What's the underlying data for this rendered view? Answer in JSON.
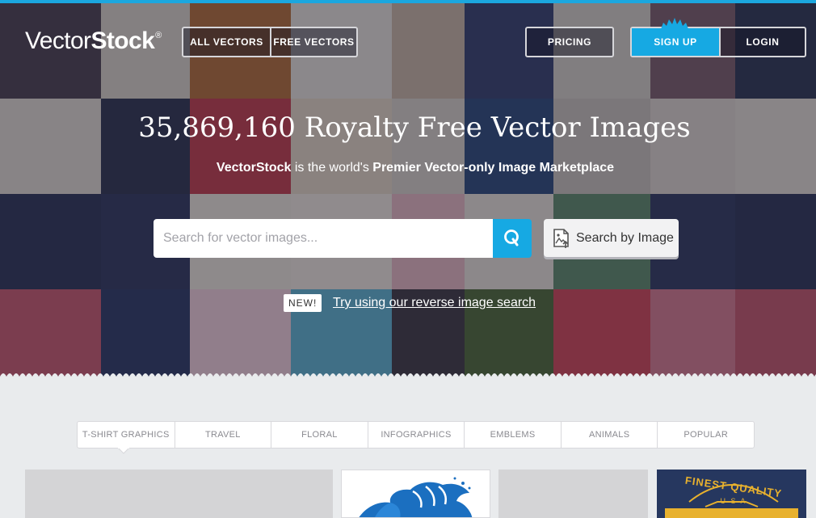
{
  "header": {
    "logo": {
      "light": "Vector",
      "bold": "Stock",
      "mark": "®"
    },
    "nav_left": [
      {
        "label": "ALL VECTORS"
      },
      {
        "label": "FREE VECTORS"
      }
    ],
    "pricing_label": "PRICING",
    "signup_label": "SIGN UP",
    "login_label": "LOGIN"
  },
  "hero": {
    "headline": "35,869,160 Royalty Free Vector Images",
    "sub_brand": "VectorStock",
    "sub_middle": " is the world's ",
    "sub_bold": "Premier Vector-only Image Marketplace",
    "search": {
      "placeholder": "Search for vector images...",
      "button_icon": "search-icon"
    },
    "image_search": {
      "label": "Search by Image",
      "icon": "image-upload-icon"
    },
    "new_badge": "NEW!",
    "reverse_link": "Try using our reverse image search"
  },
  "categories": {
    "tabs": [
      "T-SHIRT GRAPHICS",
      "TRAVEL",
      "FLORAL",
      "INFOGRAPHICS",
      "EMBLEMS",
      "ANIMALS",
      "POPULAR"
    ],
    "active_index": 0
  },
  "thumbnails": {
    "badge_text": "FINEST QUALITY",
    "badge_sub": "U S A"
  },
  "colors": {
    "accent": "#16a9e3",
    "page_bg": "#e9ebed",
    "hero_dark": "#3a3644"
  }
}
